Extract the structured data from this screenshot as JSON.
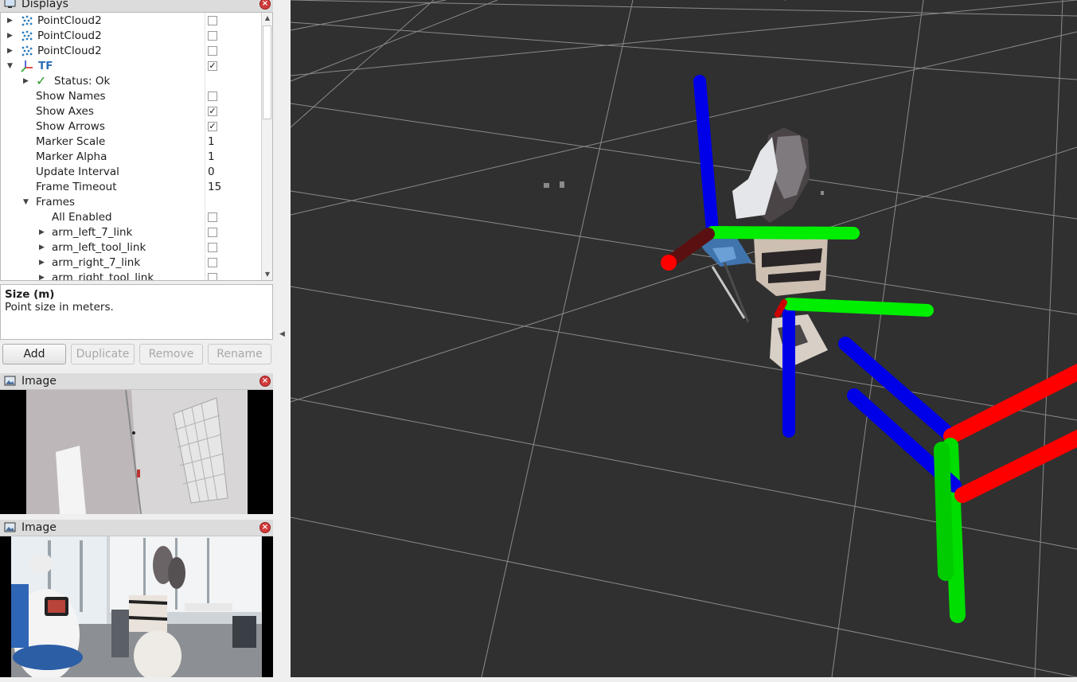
{
  "displays_panel": {
    "title": "Displays",
    "tree": [
      {
        "label": "PointCloud2",
        "icon": "pointcloud-icon",
        "checked": false,
        "expander": "collapsed"
      },
      {
        "label": "PointCloud2",
        "icon": "pointcloud-icon",
        "checked": false,
        "expander": "collapsed"
      },
      {
        "label": "PointCloud2",
        "icon": "pointcloud-icon",
        "checked": false,
        "expander": "collapsed"
      },
      {
        "label": "TF",
        "icon": "tf-axes-icon",
        "checked": true,
        "expander": "expanded"
      },
      {
        "label": "Status: Ok",
        "icon": "check-icon",
        "expander": "collapsed"
      },
      {
        "label": "Show Names",
        "checked": false
      },
      {
        "label": "Show Axes",
        "checked": true
      },
      {
        "label": "Show Arrows",
        "checked": true
      },
      {
        "label": "Marker Scale",
        "value": "1"
      },
      {
        "label": "Marker Alpha",
        "value": "1"
      },
      {
        "label": "Update Interval",
        "value": "0"
      },
      {
        "label": "Frame Timeout",
        "value": "15"
      },
      {
        "label": "Frames",
        "expander": "expanded"
      },
      {
        "label": "All Enabled",
        "checked": false
      },
      {
        "label": "arm_left_7_link",
        "checked": false,
        "expander": "collapsed"
      },
      {
        "label": "arm_left_tool_link",
        "checked": false,
        "expander": "collapsed"
      },
      {
        "label": "arm_right_7_link",
        "checked": false,
        "expander": "collapsed"
      },
      {
        "label": "arm_right_tool_link",
        "checked": false,
        "expander": "collapsed"
      }
    ]
  },
  "description": {
    "title": "Size (m)",
    "text": "Point size in meters."
  },
  "buttons": {
    "add": "Add",
    "duplicate": "Duplicate",
    "remove": "Remove",
    "rename": "Rename"
  },
  "image_panels": [
    {
      "title": "Image"
    },
    {
      "title": "Image"
    }
  ],
  "colors": {
    "viewport_bg": "#303030",
    "grid": "#9a9a9a",
    "axis_x": "#ff0000",
    "axis_y": "#00ff00",
    "axis_z": "#0000ff",
    "tf_label": "#2b6fb6"
  }
}
